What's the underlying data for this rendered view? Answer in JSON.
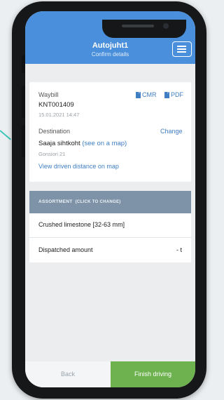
{
  "header": {
    "title": "Autojuht1",
    "subtitle": "Confirm details"
  },
  "waybill": {
    "label": "Waybill",
    "number": "KNT001409",
    "datetime": "15.01.2021 14:47",
    "cmr_label": "CMR",
    "pdf_label": "PDF"
  },
  "destination": {
    "label": "Destination",
    "change_label": "Change",
    "name": "Saaja sihtkoht",
    "map_link": "(see on a map)",
    "address": "Gonsiori 21",
    "distance_link": "View driven distance on map"
  },
  "assortment": {
    "header": "ASSORTMENT",
    "header_hint": "(CLICK TO CHANGE)",
    "product": "Crushed limestone [32-63 mm]",
    "dispatched_label": "Dispatched amount",
    "dispatched_value": "- t"
  },
  "footer": {
    "back_label": "Back",
    "finish_label": "Finish driving"
  },
  "colors": {
    "header": "#4a8fdc",
    "finish": "#6db24f",
    "assortment_header": "#7e93a7",
    "link": "#3f7ec2"
  }
}
